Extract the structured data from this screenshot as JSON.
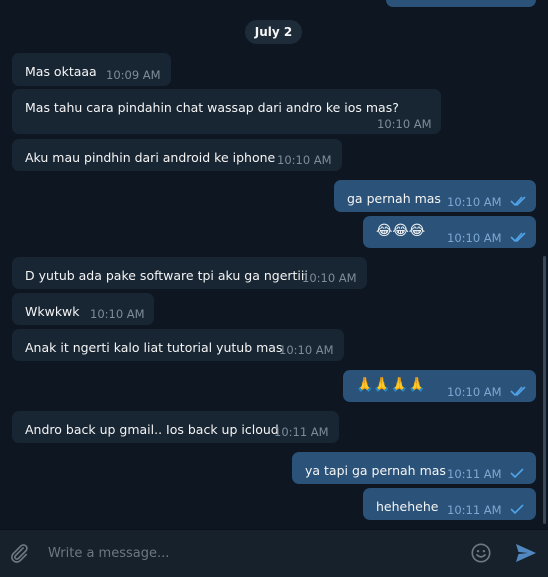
{
  "date_divider": "July 2",
  "messages": [
    {
      "text": "Mas oktaaa",
      "time": "10:09 AM",
      "dir": "in"
    },
    {
      "text": "Mas tahu cara pindahin chat wassap dari andro ke ios mas?",
      "time": "10:10 AM",
      "dir": "in"
    },
    {
      "text": "Aku mau pindhin dari android ke iphone",
      "time": "10:10 AM",
      "dir": "in"
    },
    {
      "text": "ga pernah mas",
      "time": "10:10 AM",
      "dir": "out",
      "status": "read"
    },
    {
      "text": "😂😂😂",
      "time": "10:10 AM",
      "dir": "out",
      "status": "read"
    },
    {
      "text": "D yutub ada pake software tpi aku ga ngertiii",
      "time": "10:10 AM",
      "dir": "in"
    },
    {
      "text": "Wkwkwk",
      "time": "10:10 AM",
      "dir": "in"
    },
    {
      "text": "Anak it ngerti kalo liat tutorial yutub mas",
      "time": "10:10 AM",
      "dir": "in"
    },
    {
      "text": "🙏🙏🙏🙏",
      "time": "10:10 AM",
      "dir": "out",
      "status": "read"
    },
    {
      "text": "Andro back up gmail.. Ios back up icloud",
      "time": "10:11 AM",
      "dir": "in"
    },
    {
      "text": "ya tapi ga pernah mas",
      "time": "10:11 AM",
      "dir": "out",
      "status": "sent"
    },
    {
      "text": "hehehehe",
      "time": "10:11 AM",
      "dir": "out",
      "status": "sent"
    }
  ],
  "composer": {
    "placeholder": "Write a message...",
    "attach_icon": "paperclip-icon",
    "emoji_icon": "emoji-icon",
    "send_icon": "send-icon"
  },
  "colors": {
    "background": "#0e1621",
    "incoming_bubble": "#182533",
    "outgoing_bubble": "#2b5278",
    "read_check": "#4fa3e8",
    "accent": "#5288c1"
  }
}
